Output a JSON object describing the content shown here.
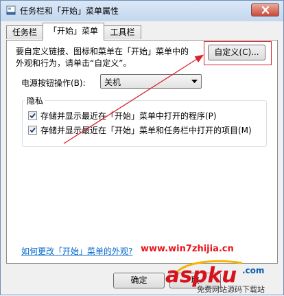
{
  "window": {
    "title": "任务栏和「开始」菜单属性"
  },
  "tabs": [
    {
      "label": "任务栏"
    },
    {
      "label": "「开始」菜单"
    },
    {
      "label": "工具栏"
    }
  ],
  "start_menu": {
    "description_line1": "要自定义链接、图标和菜单在「开始」菜单中的",
    "description_line2": "外观和行为，请单击“自定义”。",
    "customize_label": "自定义(C)...",
    "power_label": "电源按钮操作(B):",
    "power_value": "关机",
    "privacy_title": "隐私",
    "privacy_options": [
      {
        "label": "存储并显示最近在「开始」菜单中打开的程序(P)",
        "checked": true
      },
      {
        "label": "存储并显示最近在「开始」菜单和任务栏中打开的项目(M)",
        "checked": true
      }
    ],
    "help_link": "如何更改「开始」菜单的外观?"
  },
  "footer": {
    "ok_label": "确定",
    "cancel_label": "取"
  },
  "watermark": {
    "url": "www.win7zhijia.cn",
    "logo_text": "aspku",
    "logo_com": ".com",
    "logo_subtitle": "免费网站源码下载站"
  },
  "colors": {
    "annotation": "#d9232d",
    "link": "#0066cc",
    "accent": "#0a5fb0"
  }
}
